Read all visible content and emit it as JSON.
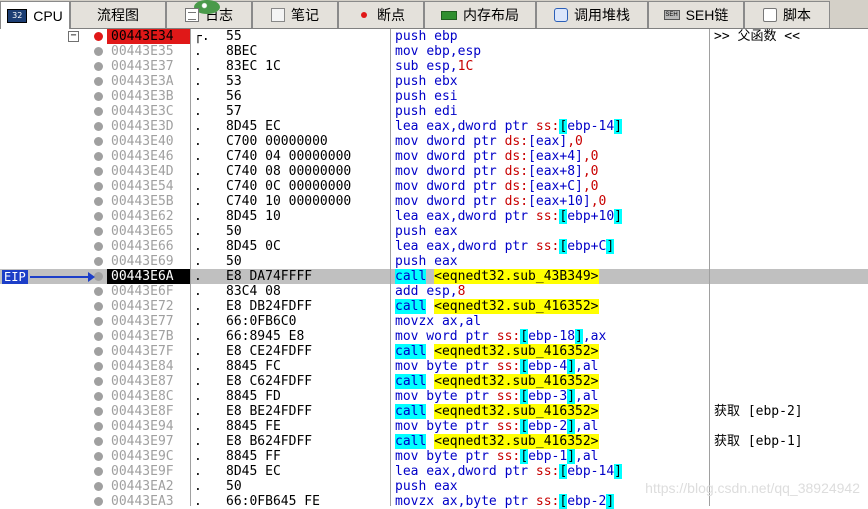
{
  "tabs": [
    {
      "label": "CPU",
      "icon": "cpu-icon",
      "iconText": "32",
      "active": true,
      "w": 70
    },
    {
      "label": "流程图",
      "icon": "flowchart-icon",
      "w": 96
    },
    {
      "label": "日志",
      "icon": "log-icon",
      "w": 86
    },
    {
      "label": "笔记",
      "icon": "notes-icon",
      "w": 86
    },
    {
      "label": "断点",
      "icon": "breakpoint-icon",
      "w": 86
    },
    {
      "label": "内存布局",
      "icon": "memory-map-icon",
      "w": 112
    },
    {
      "label": "调用堆栈",
      "icon": "call-stack-icon",
      "w": 112
    },
    {
      "label": "SEH链",
      "icon": "seh-icon",
      "iconText": "SEH",
      "w": 96
    },
    {
      "label": "脚本",
      "icon": "script-icon",
      "w": 86
    }
  ],
  "eip_label": "EIP",
  "fold_symbol": "−",
  "watermark": "https://blog.csdn.net/qq_38924942",
  "rows": [
    {
      "addr": "00443E34",
      "flow": "┌.",
      "hex": "55",
      "asm": [
        [
          "push ",
          "t"
        ],
        [
          "ebp",
          "r"
        ]
      ],
      "bp": true,
      "comment": ">> 父函数 <<"
    },
    {
      "addr": "00443E35",
      "flow": ".",
      "hex": "8BEC",
      "asm": [
        [
          "mov ",
          "t"
        ],
        [
          "ebp,esp",
          "r"
        ]
      ]
    },
    {
      "addr": "00443E37",
      "flow": ".",
      "hex": "83EC 1C",
      "asm": [
        [
          "sub ",
          "t"
        ],
        [
          "esp,",
          "r"
        ],
        [
          "1C",
          "n"
        ]
      ]
    },
    {
      "addr": "00443E3A",
      "flow": ".",
      "hex": "53",
      "asm": [
        [
          "push ",
          "t"
        ],
        [
          "ebx",
          "r"
        ]
      ]
    },
    {
      "addr": "00443E3B",
      "flow": ".",
      "hex": "56",
      "asm": [
        [
          "push ",
          "t"
        ],
        [
          "esi",
          "r"
        ]
      ]
    },
    {
      "addr": "00443E3C",
      "flow": ".",
      "hex": "57",
      "asm": [
        [
          "push ",
          "t"
        ],
        [
          "edi",
          "r"
        ]
      ]
    },
    {
      "addr": "00443E3D",
      "flow": ".",
      "hex": "8D45 EC",
      "asm": [
        [
          "lea eax,dword ptr ",
          "t"
        ],
        [
          "ss:",
          "s"
        ],
        [
          "[",
          "b"
        ],
        [
          "ebp-14",
          "r"
        ],
        [
          "]",
          "b"
        ]
      ]
    },
    {
      "addr": "00443E40",
      "flow": ".",
      "hex": "C700 00000000",
      "asm": [
        [
          "mov dword ptr ",
          "t"
        ],
        [
          "ds:",
          "s"
        ],
        [
          "[eax]",
          "r"
        ],
        [
          ",0",
          "n"
        ]
      ]
    },
    {
      "addr": "00443E46",
      "flow": ".",
      "hex": "C740 04 00000000",
      "asm": [
        [
          "mov dword ptr ",
          "t"
        ],
        [
          "ds:",
          "s"
        ],
        [
          "[eax+4]",
          "r"
        ],
        [
          ",0",
          "n"
        ]
      ]
    },
    {
      "addr": "00443E4D",
      "flow": ".",
      "hex": "C740 08 00000000",
      "asm": [
        [
          "mov dword ptr ",
          "t"
        ],
        [
          "ds:",
          "s"
        ],
        [
          "[eax+8]",
          "r"
        ],
        [
          ",0",
          "n"
        ]
      ]
    },
    {
      "addr": "00443E54",
      "flow": ".",
      "hex": "C740 0C 00000000",
      "asm": [
        [
          "mov dword ptr ",
          "t"
        ],
        [
          "ds:",
          "s"
        ],
        [
          "[eax+C]",
          "r"
        ],
        [
          ",0",
          "n"
        ]
      ]
    },
    {
      "addr": "00443E5B",
      "flow": ".",
      "hex": "C740 10 00000000",
      "asm": [
        [
          "mov dword ptr ",
          "t"
        ],
        [
          "ds:",
          "s"
        ],
        [
          "[eax+10]",
          "r"
        ],
        [
          ",0",
          "n"
        ]
      ]
    },
    {
      "addr": "00443E62",
      "flow": ".",
      "hex": "8D45 10",
      "asm": [
        [
          "lea eax,dword ptr ",
          "t"
        ],
        [
          "ss:",
          "s"
        ],
        [
          "[",
          "b"
        ],
        [
          "ebp+10",
          "r"
        ],
        [
          "]",
          "b"
        ]
      ]
    },
    {
      "addr": "00443E65",
      "flow": ".",
      "hex": "50",
      "asm": [
        [
          "push ",
          "t"
        ],
        [
          "eax",
          "r"
        ]
      ]
    },
    {
      "addr": "00443E66",
      "flow": ".",
      "hex": "8D45 0C",
      "asm": [
        [
          "lea eax,dword ptr ",
          "t"
        ],
        [
          "ss:",
          "s"
        ],
        [
          "[",
          "b"
        ],
        [
          "ebp+C",
          "r"
        ],
        [
          "]",
          "b"
        ]
      ]
    },
    {
      "addr": "00443E69",
      "flow": ".",
      "hex": "50",
      "asm": [
        [
          "push ",
          "t"
        ],
        [
          "eax",
          "r"
        ]
      ]
    },
    {
      "addr": "00443E6A",
      "flow": ".",
      "hex": "E8 DA74FFFF",
      "asm": [
        [
          "call",
          "c"
        ],
        [
          " ",
          "t"
        ],
        [
          "<eqnedt32.sub_43B349>",
          "y"
        ]
      ],
      "eip": true
    },
    {
      "addr": "00443E6F",
      "flow": ".",
      "hex": "83C4 08",
      "asm": [
        [
          "add ",
          "t"
        ],
        [
          "esp,",
          "r"
        ],
        [
          "8",
          "n"
        ]
      ]
    },
    {
      "addr": "00443E72",
      "flow": ".",
      "hex": "E8 DB24FDFF",
      "asm": [
        [
          "call",
          "c"
        ],
        [
          " ",
          "t"
        ],
        [
          "<eqnedt32.sub_416352>",
          "y"
        ]
      ]
    },
    {
      "addr": "00443E77",
      "flow": ".",
      "hex": "66:0FB6C0",
      "asm": [
        [
          "movzx ",
          "t"
        ],
        [
          "ax,al",
          "r"
        ]
      ]
    },
    {
      "addr": "00443E7B",
      "flow": ".",
      "hex": "66:8945 E8",
      "asm": [
        [
          "mov word ptr ",
          "t"
        ],
        [
          "ss:",
          "s"
        ],
        [
          "[",
          "b"
        ],
        [
          "ebp-18",
          "r"
        ],
        [
          "]",
          "b"
        ],
        [
          ",ax",
          "r"
        ]
      ]
    },
    {
      "addr": "00443E7F",
      "flow": ".",
      "hex": "E8 CE24FDFF",
      "asm": [
        [
          "call",
          "c"
        ],
        [
          " ",
          "t"
        ],
        [
          "<eqnedt32.sub_416352>",
          "y"
        ]
      ]
    },
    {
      "addr": "00443E84",
      "flow": ".",
      "hex": "8845 FC",
      "asm": [
        [
          "mov byte ptr ",
          "t"
        ],
        [
          "ss:",
          "s"
        ],
        [
          "[",
          "b"
        ],
        [
          "ebp-4",
          "r"
        ],
        [
          "]",
          "b"
        ],
        [
          ",al",
          "r"
        ]
      ]
    },
    {
      "addr": "00443E87",
      "flow": ".",
      "hex": "E8 C624FDFF",
      "asm": [
        [
          "call",
          "c"
        ],
        [
          " ",
          "t"
        ],
        [
          "<eqnedt32.sub_416352>",
          "y"
        ]
      ]
    },
    {
      "addr": "00443E8C",
      "flow": ".",
      "hex": "8845 FD",
      "asm": [
        [
          "mov byte ptr ",
          "t"
        ],
        [
          "ss:",
          "s"
        ],
        [
          "[",
          "b"
        ],
        [
          "ebp-3",
          "r"
        ],
        [
          "]",
          "b"
        ],
        [
          ",al",
          "r"
        ]
      ]
    },
    {
      "addr": "00443E8F",
      "flow": ".",
      "hex": "E8 BE24FDFF",
      "asm": [
        [
          "call",
          "c"
        ],
        [
          " ",
          "t"
        ],
        [
          "<eqnedt32.sub_416352>",
          "y"
        ]
      ],
      "comment": "获取 [ebp-2]"
    },
    {
      "addr": "00443E94",
      "flow": ".",
      "hex": "8845 FE",
      "asm": [
        [
          "mov byte ptr ",
          "t"
        ],
        [
          "ss:",
          "s"
        ],
        [
          "[",
          "b"
        ],
        [
          "ebp-2",
          "r"
        ],
        [
          "]",
          "b"
        ],
        [
          ",al",
          "r"
        ]
      ]
    },
    {
      "addr": "00443E97",
      "flow": ".",
      "hex": "E8 B624FDFF",
      "asm": [
        [
          "call",
          "c"
        ],
        [
          " ",
          "t"
        ],
        [
          "<eqnedt32.sub_416352>",
          "y"
        ]
      ],
      "comment": "获取 [ebp-1]"
    },
    {
      "addr": "00443E9C",
      "flow": ".",
      "hex": "8845 FF",
      "asm": [
        [
          "mov byte ptr ",
          "t"
        ],
        [
          "ss:",
          "s"
        ],
        [
          "[",
          "b"
        ],
        [
          "ebp-1",
          "r"
        ],
        [
          "]",
          "b"
        ],
        [
          ",al",
          "r"
        ]
      ]
    },
    {
      "addr": "00443E9F",
      "flow": ".",
      "hex": "8D45 EC",
      "asm": [
        [
          "lea eax,dword ptr ",
          "t"
        ],
        [
          "ss:",
          "s"
        ],
        [
          "[",
          "b"
        ],
        [
          "ebp-14",
          "r"
        ],
        [
          "]",
          "b"
        ]
      ]
    },
    {
      "addr": "00443EA2",
      "flow": ".",
      "hex": "50",
      "asm": [
        [
          "push ",
          "t"
        ],
        [
          "eax",
          "r"
        ]
      ]
    },
    {
      "addr": "00443EA3",
      "flow": ".",
      "hex": "66:0FB645 FE",
      "asm": [
        [
          "movzx ax,byte ptr ",
          "t"
        ],
        [
          "ss:",
          "s"
        ],
        [
          "[",
          "b"
        ],
        [
          "ebp-2",
          "r"
        ],
        [
          "]",
          "b"
        ]
      ]
    }
  ]
}
